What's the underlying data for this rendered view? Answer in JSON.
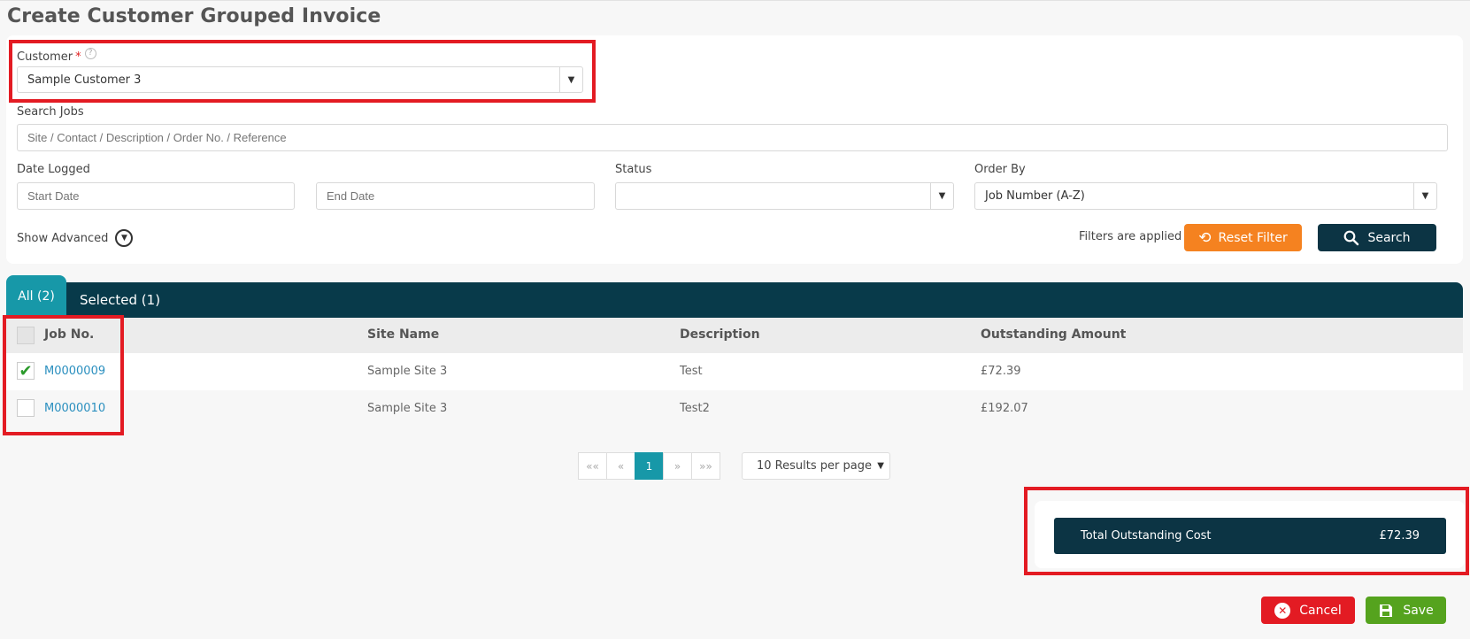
{
  "page": {
    "title": "Create Customer Grouped Invoice"
  },
  "filters": {
    "customer_label": "Customer",
    "required_mark": "*",
    "help_glyph": "?",
    "customer_value": "Sample Customer 3",
    "search_jobs_label": "Search Jobs",
    "search_jobs_placeholder": "Site / Contact / Description / Order No. / Reference",
    "date_logged_label": "Date Logged",
    "start_date_placeholder": "Start Date",
    "end_date_placeholder": "End Date",
    "status_label": "Status",
    "status_value": "",
    "order_by_label": "Order By",
    "order_by_value": "Job Number (A-Z)",
    "show_advanced_label": "Show Advanced",
    "filters_applied_text": "Filters are applied",
    "reset_filter_label": "Reset Filter",
    "search_label": "Search"
  },
  "tabs": [
    {
      "label": "All (2)",
      "active": true
    },
    {
      "label": "Selected (1)",
      "active": false
    }
  ],
  "table": {
    "columns": [
      "Job No.",
      "Site Name",
      "Description",
      "Outstanding Amount"
    ],
    "rows": [
      {
        "job_no": "M0000009",
        "site_name": "Sample Site 3",
        "description": "Test",
        "outstanding": "£72.39",
        "checked": true
      },
      {
        "job_no": "M0000010",
        "site_name": "Sample Site 3",
        "description": "Test2",
        "outstanding": "£192.07",
        "checked": false
      }
    ]
  },
  "pagination": {
    "first": "««",
    "prev": "«",
    "current": "1",
    "next": "»",
    "last": "»»",
    "per_page": "10 Results per page"
  },
  "summary": {
    "label": "Total Outstanding Cost",
    "value": "£72.39"
  },
  "actions": {
    "cancel_label": "Cancel",
    "save_label": "Save"
  },
  "colors": {
    "accent_teal": "#1798a8",
    "dark_navy": "#083a4a",
    "reset_orange": "#f58220",
    "cancel_red": "#e31b23",
    "save_green": "#55a31e",
    "highlight_red": "#e31b23"
  }
}
